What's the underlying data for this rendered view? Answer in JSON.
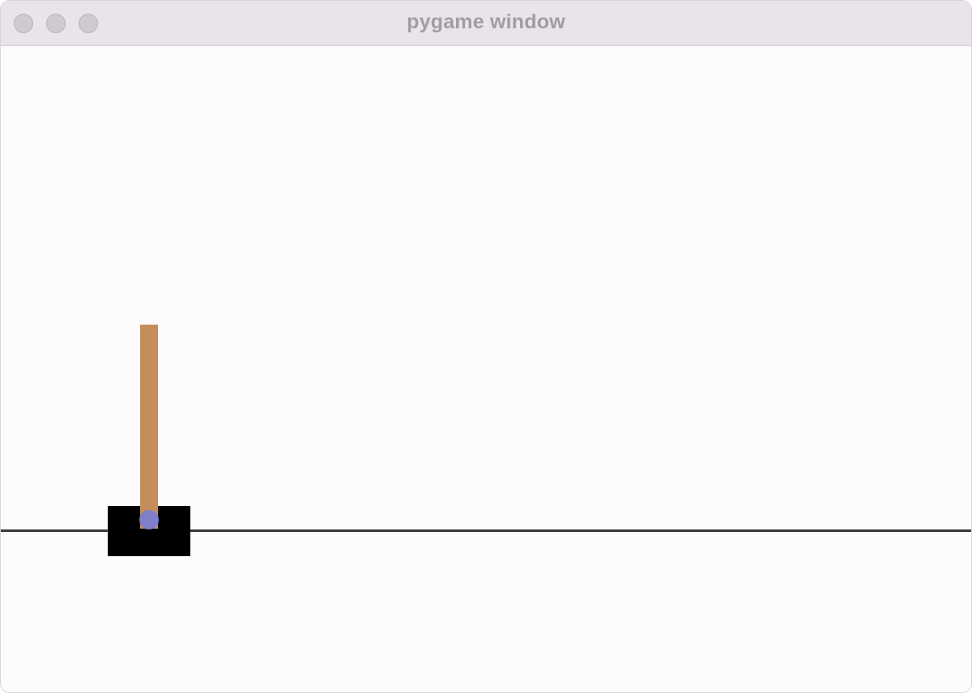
{
  "window": {
    "title": "pygame window",
    "controls": [
      "close-icon",
      "minimize-icon",
      "zoom-icon"
    ]
  },
  "scene": {
    "game": "cartpole",
    "colors": {
      "background": "#fcfcfc",
      "track": "#3a3a3a",
      "cart": "#000000",
      "pole": "#c58d5b",
      "axle": "#7f7fc9"
    }
  }
}
